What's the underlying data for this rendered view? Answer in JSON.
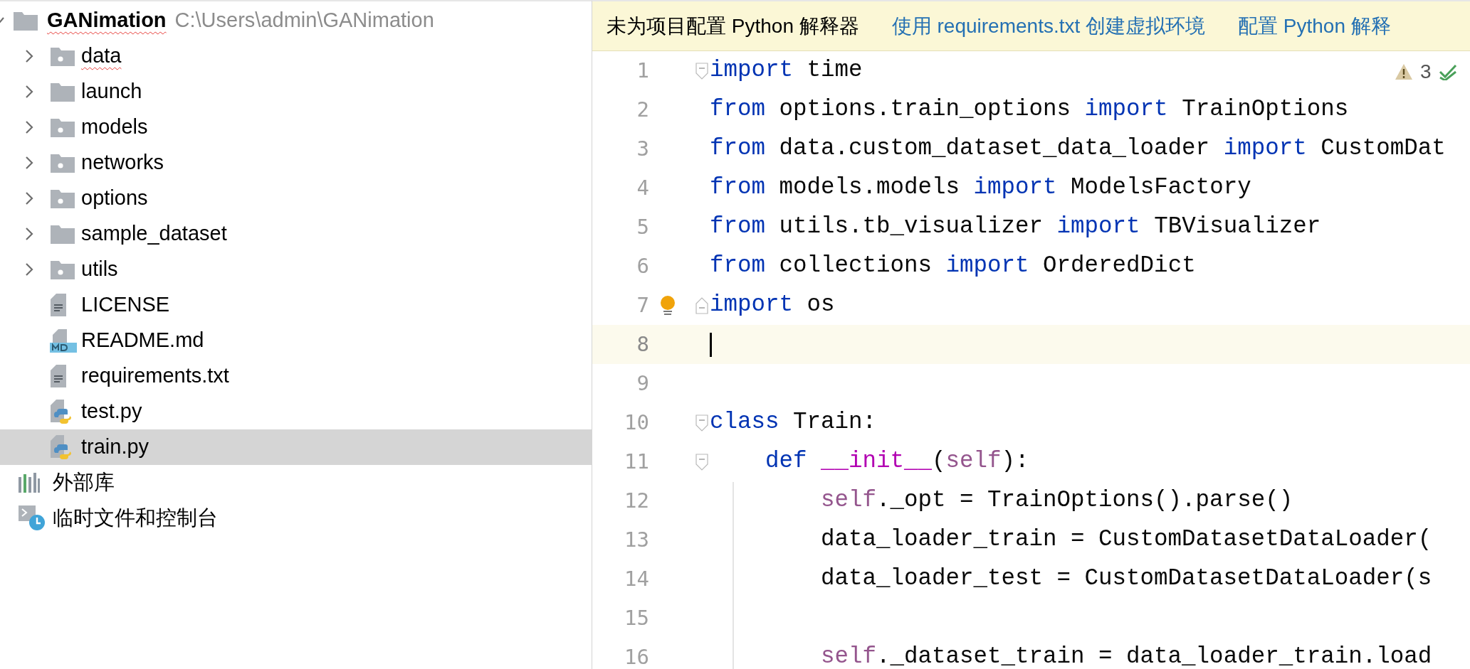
{
  "project_tree": {
    "root": {
      "name": "GANimation",
      "path": "C:\\Users\\admin\\GANimation",
      "expanded": true,
      "misspelled": true,
      "children": [
        {
          "name": "data",
          "kind": "package",
          "expanded": false,
          "misspelled": true,
          "selected": false
        },
        {
          "name": "launch",
          "kind": "folder",
          "expanded": false,
          "misspelled": false,
          "selected": false
        },
        {
          "name": "models",
          "kind": "package",
          "expanded": false,
          "misspelled": false,
          "selected": false
        },
        {
          "name": "networks",
          "kind": "package",
          "expanded": false,
          "misspelled": false,
          "selected": false
        },
        {
          "name": "options",
          "kind": "package",
          "expanded": false,
          "misspelled": false,
          "selected": false
        },
        {
          "name": "sample_dataset",
          "kind": "folder",
          "expanded": false,
          "misspelled": false,
          "selected": false
        },
        {
          "name": "utils",
          "kind": "package",
          "expanded": false,
          "misspelled": false,
          "selected": false
        },
        {
          "name": "LICENSE",
          "kind": "text",
          "misspelled": false,
          "selected": false
        },
        {
          "name": "README.md",
          "kind": "markdown",
          "misspelled": false,
          "selected": false
        },
        {
          "name": "requirements.txt",
          "kind": "text",
          "misspelled": false,
          "selected": false
        },
        {
          "name": "test.py",
          "kind": "python",
          "misspelled": false,
          "selected": false
        },
        {
          "name": "train.py",
          "kind": "python",
          "misspelled": false,
          "selected": true
        }
      ]
    },
    "extra_items": [
      {
        "label": "外部库",
        "kind": "library"
      },
      {
        "label": "临时文件和控制台",
        "kind": "scratches"
      }
    ]
  },
  "notification_bar": {
    "message": "未为项目配置 Python 解释器",
    "links": [
      "使用 requirements.txt 创建虚拟环境",
      "配置 Python 解释"
    ]
  },
  "editor": {
    "inspection": {
      "warnings": "3"
    },
    "lines": [
      {
        "number": "1",
        "fold_start": true,
        "fold_end": false,
        "current": false,
        "bulb": false,
        "tokens": [
          {
            "kind": "kw",
            "text": "import"
          },
          {
            "kind": "plain",
            "text": " time"
          }
        ]
      },
      {
        "number": "2",
        "fold_start": false,
        "fold_end": false,
        "current": false,
        "bulb": false,
        "tokens": [
          {
            "kind": "kw",
            "text": "from"
          },
          {
            "kind": "plain",
            "text": " options.train_options "
          },
          {
            "kind": "kw",
            "text": "import"
          },
          {
            "kind": "plain",
            "text": " TrainOptions"
          }
        ]
      },
      {
        "number": "3",
        "fold_start": false,
        "fold_end": false,
        "current": false,
        "bulb": false,
        "tokens": [
          {
            "kind": "kw",
            "text": "from"
          },
          {
            "kind": "plain",
            "text": " data.custom_dataset_data_loader "
          },
          {
            "kind": "kw",
            "text": "import"
          },
          {
            "kind": "plain",
            "text": " CustomDat"
          }
        ]
      },
      {
        "number": "4",
        "fold_start": false,
        "fold_end": false,
        "current": false,
        "bulb": false,
        "tokens": [
          {
            "kind": "kw",
            "text": "from"
          },
          {
            "kind": "plain",
            "text": " models.models "
          },
          {
            "kind": "kw",
            "text": "import"
          },
          {
            "kind": "plain",
            "text": " ModelsFactory"
          }
        ]
      },
      {
        "number": "5",
        "fold_start": false,
        "fold_end": false,
        "current": false,
        "bulb": false,
        "tokens": [
          {
            "kind": "kw",
            "text": "from"
          },
          {
            "kind": "plain",
            "text": " utils.tb_visualizer "
          },
          {
            "kind": "kw",
            "text": "import"
          },
          {
            "kind": "plain",
            "text": " TBVisualizer"
          }
        ]
      },
      {
        "number": "6",
        "fold_start": false,
        "fold_end": false,
        "current": false,
        "bulb": false,
        "tokens": [
          {
            "kind": "kw",
            "text": "from"
          },
          {
            "kind": "plain",
            "text": " collections "
          },
          {
            "kind": "kw",
            "text": "import"
          },
          {
            "kind": "plain",
            "text": " OrderedDict"
          }
        ]
      },
      {
        "number": "7",
        "fold_start": false,
        "fold_end": true,
        "current": false,
        "bulb": true,
        "tokens": [
          {
            "kind": "kw",
            "text": "import"
          },
          {
            "kind": "plain",
            "text": " os"
          }
        ]
      },
      {
        "number": "8",
        "fold_start": false,
        "fold_end": false,
        "current": true,
        "bulb": false
      },
      {
        "number": "9",
        "fold_start": false,
        "fold_end": false,
        "current": false,
        "bulb": false
      },
      {
        "number": "10",
        "fold_start": true,
        "fold_end": false,
        "current": false,
        "bulb": false,
        "tokens": [
          {
            "kind": "kw",
            "text": "class"
          },
          {
            "kind": "plain",
            "text": " Train:"
          }
        ]
      },
      {
        "number": "11",
        "fold_start": true,
        "fold_end": false,
        "current": false,
        "bulb": false,
        "tokens": [
          {
            "kind": "kw",
            "text": "    def"
          },
          {
            "kind": "magic",
            "text": " __init__"
          },
          {
            "kind": "plain",
            "text": "("
          },
          {
            "kind": "self",
            "text": "self"
          },
          {
            "kind": "plain",
            "text": "):"
          }
        ]
      },
      {
        "number": "12",
        "fold_start": false,
        "fold_end": false,
        "current": false,
        "bulb": false,
        "tokens": [
          {
            "kind": "self",
            "text": "        self"
          },
          {
            "kind": "plain",
            "text": "._opt = TrainOptions().parse()"
          }
        ]
      },
      {
        "number": "13",
        "fold_start": false,
        "fold_end": false,
        "current": false,
        "bulb": false,
        "tokens": [
          {
            "kind": "plain",
            "text": "        data_loader_train = CustomDatasetDataLoader("
          }
        ]
      },
      {
        "number": "14",
        "fold_start": false,
        "fold_end": false,
        "current": false,
        "bulb": false,
        "tokens": [
          {
            "kind": "plain",
            "text": "        data_loader_test = CustomDatasetDataLoader(s"
          }
        ]
      },
      {
        "number": "15",
        "fold_start": false,
        "fold_end": false,
        "current": false,
        "bulb": false
      },
      {
        "number": "16",
        "fold_start": false,
        "fold_end": false,
        "current": false,
        "bulb": false,
        "tokens": [
          {
            "kind": "self",
            "text": "        self"
          },
          {
            "kind": "plain",
            "text": "._dataset_train = data_loader_train.load"
          }
        ]
      }
    ]
  }
}
